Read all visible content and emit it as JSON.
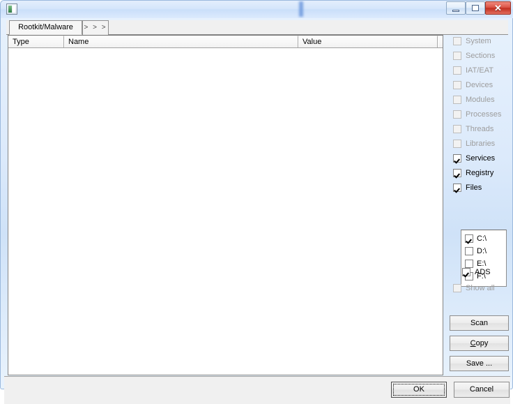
{
  "window": {
    "title": "",
    "icon": "app-icon",
    "controls": {
      "minimize": "",
      "maximize": "",
      "close": "✕"
    }
  },
  "tabs": [
    {
      "label": "Rootkit/Malware",
      "active": true
    },
    {
      "label": "> > >",
      "active": false
    }
  ],
  "list": {
    "columns": [
      "Type",
      "Name",
      "Value"
    ],
    "rows": []
  },
  "options": {
    "scan_items": [
      {
        "label": "System",
        "checked": false,
        "enabled": false
      },
      {
        "label": "Sections",
        "checked": false,
        "enabled": false
      },
      {
        "label": "IAT/EAT",
        "checked": false,
        "enabled": false
      },
      {
        "label": "Devices",
        "checked": false,
        "enabled": false
      },
      {
        "label": "Modules",
        "checked": false,
        "enabled": false
      },
      {
        "label": "Processes",
        "checked": false,
        "enabled": false
      },
      {
        "label": "Threads",
        "checked": false,
        "enabled": false
      },
      {
        "label": "Libraries",
        "checked": false,
        "enabled": false
      },
      {
        "label": "Services",
        "checked": true,
        "enabled": true
      },
      {
        "label": "Registry",
        "checked": true,
        "enabled": true
      },
      {
        "label": "Files",
        "checked": true,
        "enabled": true
      }
    ],
    "drives": [
      {
        "label": "C:\\",
        "checked": true
      },
      {
        "label": "D:\\",
        "checked": false
      },
      {
        "label": "E:\\",
        "checked": false
      },
      {
        "label": "F:\\",
        "checked": false
      }
    ],
    "ads": {
      "label": "ADS",
      "checked": true,
      "enabled": true
    },
    "show_all": {
      "label": "Show all",
      "checked": false,
      "enabled": false
    },
    "buttons": {
      "scan": "Scan",
      "copy": "Copy",
      "copy_accel": "C",
      "copy_rest": "opy",
      "save": "Save ..."
    }
  },
  "footer": {
    "ok": "OK",
    "cancel": "Cancel"
  }
}
